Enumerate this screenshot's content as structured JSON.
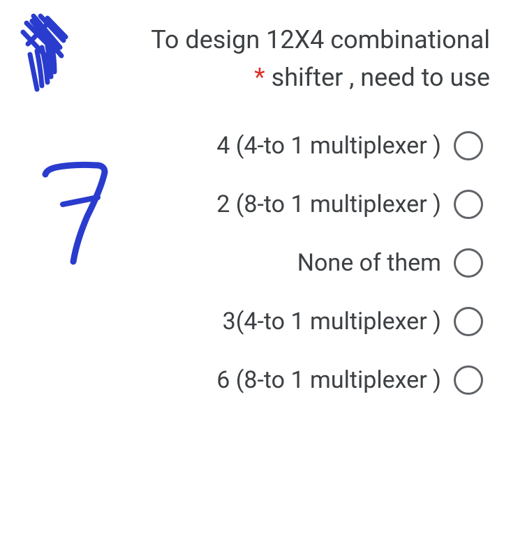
{
  "question": {
    "line1": "To design 12X4 combinational",
    "line2_after_asterisk": " shifter , need to use",
    "asterisk": "*"
  },
  "options": [
    {
      "label": "4 (4-to 1 multiplexer )"
    },
    {
      "label": "2 (8-to 1 multiplexer )"
    },
    {
      "label": "None of them"
    },
    {
      "label": "3(4-to 1 multiplexer )"
    },
    {
      "label": "6 (8-to 1 multiplexer )"
    }
  ],
  "annotations": {
    "scribble_color": "#2a3cce"
  }
}
